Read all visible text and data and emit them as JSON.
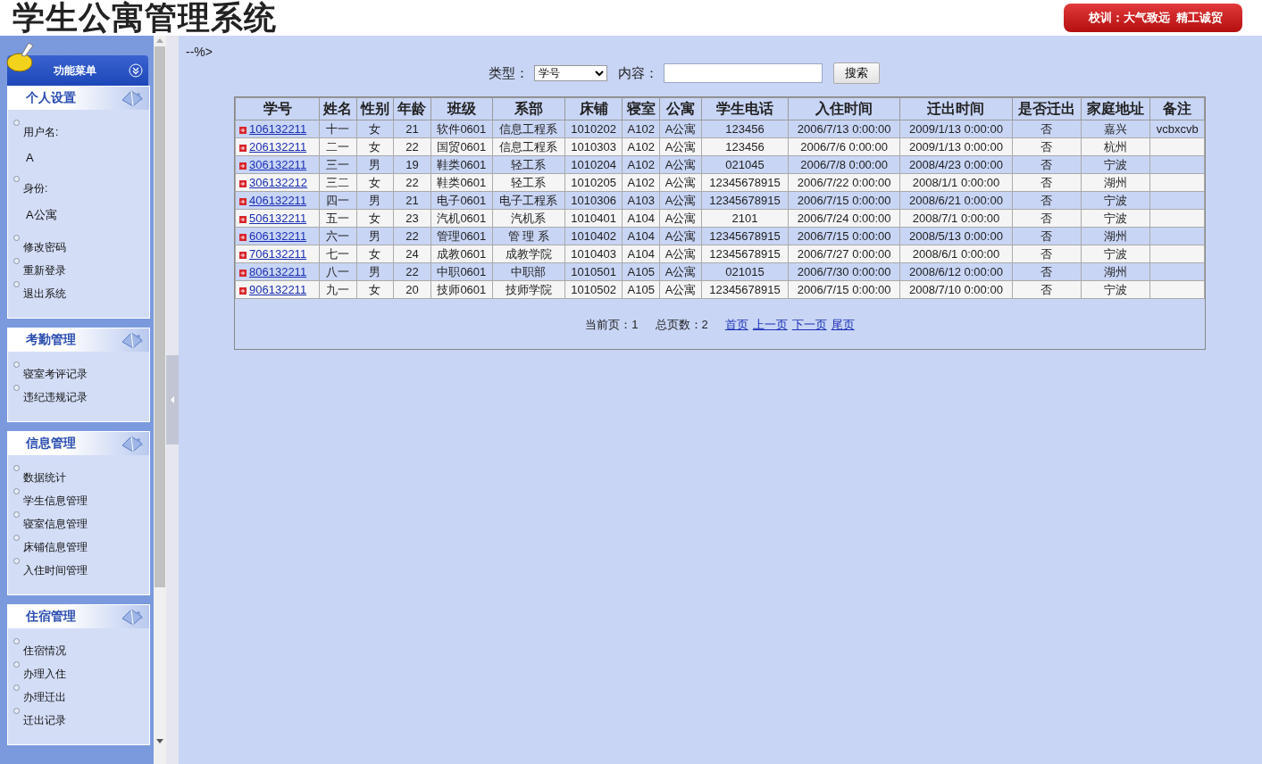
{
  "header": {
    "title": "学生公寓管理系统",
    "motto": "校训：大气致远  精工诚贸"
  },
  "sidebar": {
    "menu_title": "功能菜单",
    "sections": [
      {
        "title": "个人设置",
        "items": [
          {
            "kind": "label",
            "text": "用户名:"
          },
          {
            "kind": "value",
            "text": "A"
          },
          {
            "kind": "label",
            "text": "身份:"
          },
          {
            "kind": "value",
            "text": "A公寓"
          },
          {
            "kind": "link",
            "text": "修改密码"
          },
          {
            "kind": "link",
            "text": "重新登录"
          },
          {
            "kind": "link",
            "text": "退出系统"
          }
        ]
      },
      {
        "title": "考勤管理",
        "items": [
          {
            "kind": "link",
            "text": "寝室考评记录"
          },
          {
            "kind": "link",
            "text": "违纪违规记录"
          }
        ]
      },
      {
        "title": "信息管理",
        "items": [
          {
            "kind": "link",
            "text": "数据统计"
          },
          {
            "kind": "link",
            "text": "学生信息管理"
          },
          {
            "kind": "link",
            "text": "寝室信息管理"
          },
          {
            "kind": "link",
            "text": "床铺信息管理"
          },
          {
            "kind": "link",
            "text": "入住时间管理"
          }
        ]
      },
      {
        "title": "住宿管理",
        "items": [
          {
            "kind": "link",
            "text": "住宿情况"
          },
          {
            "kind": "link",
            "text": "办理入住"
          },
          {
            "kind": "link",
            "text": "办理迁出"
          },
          {
            "kind": "link",
            "text": "迁出记录"
          }
        ]
      }
    ]
  },
  "stray_text": "--%>",
  "search": {
    "type_label": "类型：",
    "type_value": "学号",
    "content_label": "内容：",
    "button": "搜索"
  },
  "table": {
    "columns": [
      "学号",
      "姓名",
      "性别",
      "年龄",
      "班级",
      "系部",
      "床铺",
      "寝室",
      "公寓",
      "学生电话",
      "入住时间",
      "迁出时间",
      "是否迁出",
      "家庭地址",
      "备注"
    ],
    "rows": [
      [
        "106132211",
        "十一",
        "女",
        "21",
        "软件0601",
        "信息工程系",
        "1010202",
        "A102",
        "A公寓",
        "123456",
        "2006/7/13 0:00:00",
        "2009/1/13 0:00:00",
        "否",
        "嘉兴",
        "vcbxcvb"
      ],
      [
        "206132211",
        "二一",
        "女",
        "22",
        "国贸0601",
        "信息工程系",
        "1010303",
        "A102",
        "A公寓",
        "123456",
        "2006/7/6 0:00:00",
        "2009/1/13 0:00:00",
        "否",
        "杭州",
        ""
      ],
      [
        "306132211",
        "三一",
        "男",
        "19",
        "鞋类0601",
        "轻工系",
        "1010204",
        "A102",
        "A公寓",
        "021045",
        "2006/7/8 0:00:00",
        "2008/4/23 0:00:00",
        "否",
        "宁波",
        ""
      ],
      [
        "306132212",
        "三二",
        "女",
        "22",
        "鞋类0601",
        "轻工系",
        "1010205",
        "A102",
        "A公寓",
        "12345678915",
        "2006/7/22 0:00:00",
        "2008/1/1 0:00:00",
        "否",
        "湖州",
        ""
      ],
      [
        "406132211",
        "四一",
        "男",
        "21",
        "电子0601",
        "电子工程系",
        "1010306",
        "A103",
        "A公寓",
        "12345678915",
        "2006/7/15 0:00:00",
        "2008/6/21 0:00:00",
        "否",
        "宁波",
        ""
      ],
      [
        "506132211",
        "五一",
        "女",
        "23",
        "汽机0601",
        "汽机系",
        "1010401",
        "A104",
        "A公寓",
        "2101",
        "2006/7/24 0:00:00",
        "2008/7/1 0:00:00",
        "否",
        "宁波",
        ""
      ],
      [
        "606132211",
        "六一",
        "男",
        "22",
        "管理0601",
        "管 理 系",
        "1010402",
        "A104",
        "A公寓",
        "12345678915",
        "2006/7/15 0:00:00",
        "2008/5/13 0:00:00",
        "否",
        "湖州",
        ""
      ],
      [
        "706132211",
        "七一",
        "女",
        "24",
        "成教0601",
        "成教学院",
        "1010403",
        "A104",
        "A公寓",
        "12345678915",
        "2006/7/27 0:00:00",
        "2008/6/1 0:00:00",
        "否",
        "宁波",
        ""
      ],
      [
        "806132211",
        "八一",
        "男",
        "22",
        "中职0601",
        "中职部",
        "1010501",
        "A105",
        "A公寓",
        "021015",
        "2006/7/30 0:00:00",
        "2008/6/12 0:00:00",
        "否",
        "湖州",
        ""
      ],
      [
        "906132211",
        "九一",
        "女",
        "20",
        "技师0601",
        "技师学院",
        "1010502",
        "A105",
        "A公寓",
        "12345678915",
        "2006/7/15 0:00:00",
        "2008/7/10 0:00:00",
        "否",
        "宁波",
        ""
      ]
    ]
  },
  "pagination": {
    "current": "当前页：1",
    "total": "总页数：2",
    "links": [
      "首页",
      "上一页",
      "下一页",
      "尾页"
    ]
  }
}
